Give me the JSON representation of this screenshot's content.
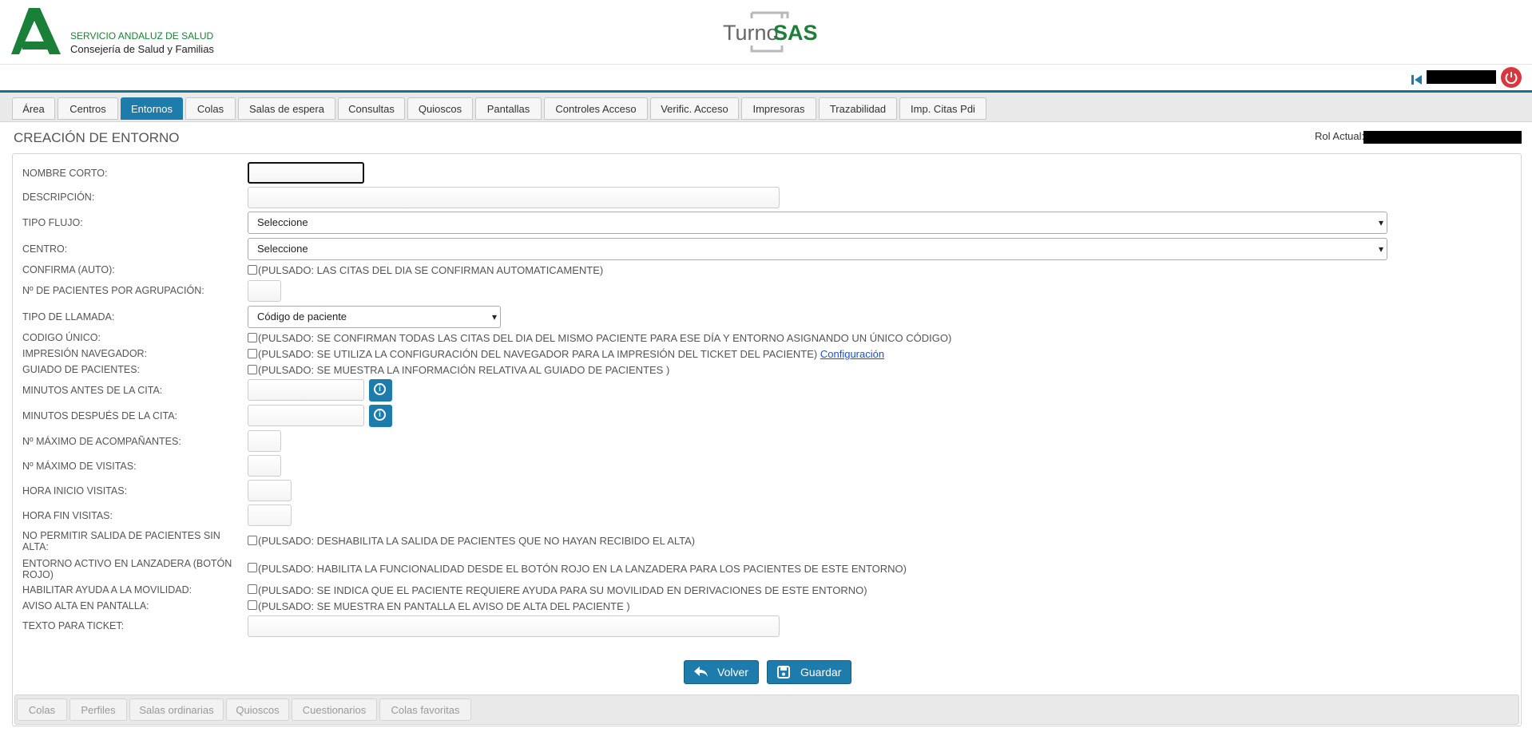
{
  "header": {
    "org_line1": "SERVICIO ANDALUZ DE SALUD",
    "org_line2": "Consejería de Salud y Familias",
    "app_name_part1": "Turno",
    "app_name_part2": "SAS",
    "brand_green": "#1a7f37",
    "accent_blue": "#1d7cab",
    "logout_red": "#d9363e"
  },
  "userbar": {
    "first_icon": "first-page-icon",
    "logout_icon": "power-icon"
  },
  "nav": {
    "tabs": [
      "Área",
      "Centros",
      "Entornos",
      "Colas",
      "Salas de espera",
      "Consultas",
      "Quioscos",
      "Pantallas",
      "Controles Acceso",
      "Verific. Acceso",
      "Impresoras",
      "Trazabilidad",
      "Imp. Citas Pdi"
    ],
    "active": "Entornos"
  },
  "page": {
    "title": "CREACIÓN DE ENTORNO",
    "role_label": "Rol Actual:"
  },
  "form": {
    "nombre_corto": "NOMBRE CORTO:",
    "descripcion": "DESCRIPCIÓN:",
    "tipo_flujo": "TIPO FLUJO:",
    "tipo_flujo_value": "Seleccione",
    "centro": "CENTRO:",
    "centro_value": "Seleccione",
    "confirma": "CONFIRMA (AUTO):",
    "confirma_text": "(PULSADO: LAS CITAS DEL DIA SE CONFIRMAN AUTOMATICAMENTE)",
    "pacientes_agrup": "Nº DE PACIENTES POR AGRUPACIÓN:",
    "tipo_llamada": "TIPO DE LLAMADA:",
    "tipo_llamada_value": "Código de paciente",
    "codigo_unico": "CODIGO ÚNICO:",
    "codigo_unico_text": "(PULSADO: SE CONFIRMAN TODAS LAS CITAS DEL DIA DEL MISMO PACIENTE PARA ESE DÍA Y ENTORNO ASIGNANDO UN ÚNICO CÓDIGO)",
    "impresion": "IMPRESIÓN NAVEGADOR:",
    "impresion_text": "(PULSADO: SE UTILIZA LA CONFIGURACIÓN DEL NAVEGADOR PARA LA IMPRESIÓN DEL TICKET DEL PACIENTE)",
    "impresion_link": "Configuración",
    "guiado": "GUIADO DE PACIENTES:",
    "guiado_text": "(PULSADO: SE MUESTRA LA INFORMACIÓN RELATIVA AL GUIADO DE PACIENTES )",
    "min_antes": "MINUTOS ANTES DE LA CITA:",
    "min_despues": "MINUTOS DESPUÉS DE LA CITA:",
    "max_acomp": "Nº MÁXIMO DE ACOMPAÑANTES:",
    "max_visitas": "Nº MÁXIMO DE VISITAS:",
    "hora_inicio": "HORA INICIO VISITAS:",
    "hora_fin": "HORA FIN VISITAS:",
    "no_salida": "NO PERMITIR SALIDA DE PACIENTES SIN ALTA:",
    "no_salida_text": "(PULSADO: DESHABILITA LA SALIDA DE PACIENTES QUE NO HAYAN RECIBIDO EL ALTA)",
    "lanzadera": "ENTORNO ACTIVO EN LANZADERA (BOTÓN ROJO)",
    "lanzadera_text": "(PULSADO: HABILITA LA FUNCIONALIDAD DESDE EL BOTÓN ROJO EN LA LANZADERA PARA LOS PACIENTES DE ESTE ENTORNO)",
    "movilidad": "HABILITAR AYUDA A LA MOVILIDAD:",
    "movilidad_text": "(PULSADO: SE INDICA QUE EL PACIENTE REQUIERE AYUDA PARA SU MOVILIDAD EN DERIVACIONES DE ESTE ENTORNO)",
    "aviso_alta": "AVISO ALTA EN PANTALLA:",
    "aviso_alta_text": "(PULSADO: SE MUESTRA EN PANTALLA EL AVISO DE ALTA DEL PACIENTE )",
    "texto_ticket": "TEXTO PARA TICKET:"
  },
  "buttons": {
    "volver": "Volver",
    "guardar": "Guardar"
  },
  "subtabs": [
    "Colas",
    "Perfiles",
    "Salas ordinarias",
    "Quioscos",
    "Cuestionarios",
    "Colas favoritas"
  ]
}
